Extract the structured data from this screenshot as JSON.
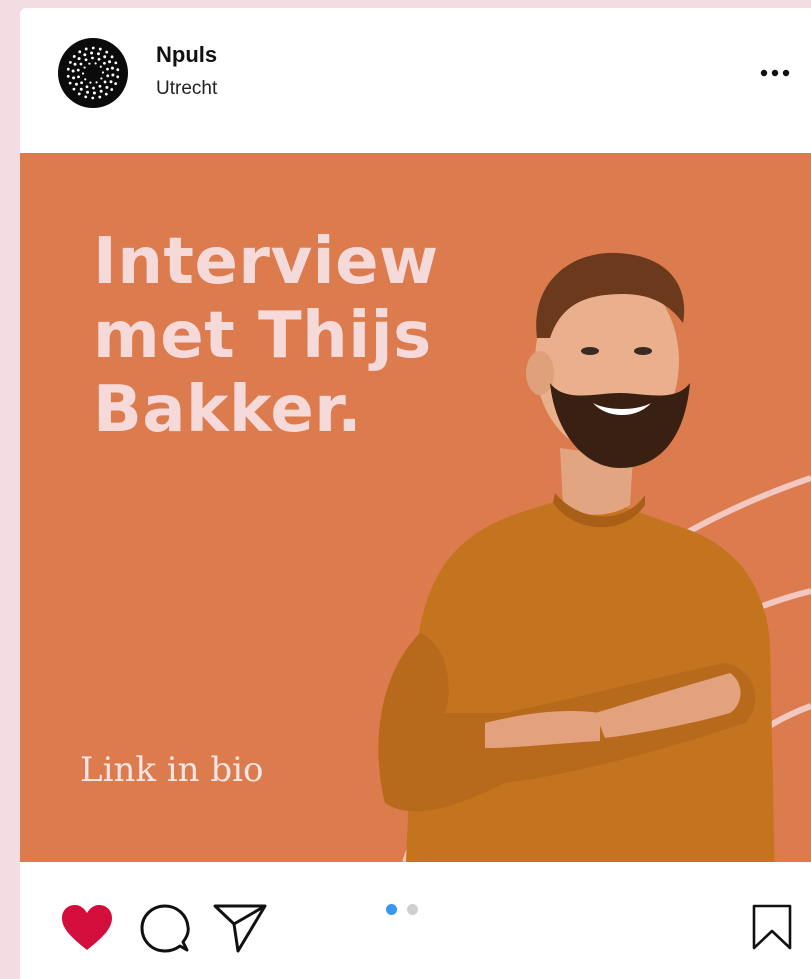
{
  "post": {
    "username": "Npuls",
    "location": "Utrecht"
  },
  "media": {
    "headline_lines": [
      "Interview",
      "met Thijs",
      "Bakker."
    ],
    "bio_text": "Link in bio",
    "background_color": "#dc7b4e",
    "headline_color": "#f6d9d9"
  },
  "carousel": {
    "total": 2,
    "active_index": 1,
    "active_color": "#3897f0",
    "inactive_color": "#cfcfcf"
  },
  "actions": {
    "liked": true,
    "like_color": "#d40e3c",
    "icons": [
      "heart-icon",
      "comment-icon",
      "share-icon",
      "bookmark-icon"
    ]
  }
}
